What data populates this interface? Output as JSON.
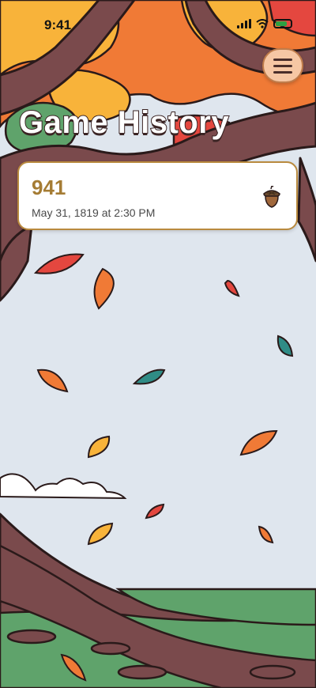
{
  "status_bar": {
    "time": "9:41"
  },
  "header": {
    "title": "Game History"
  },
  "menu": {
    "icon": "hamburger-menu-icon"
  },
  "history": [
    {
      "score": "941",
      "date": "May 31, 1819 at 2:30 PM",
      "icon": "acorn-icon"
    }
  ],
  "colors": {
    "sky": "#dfe6ee",
    "trunk": "#7a4a4c",
    "outline": "#2a1a1a",
    "leaf_orange": "#f07a36",
    "leaf_yellow": "#f8b33a",
    "leaf_red": "#e4473f",
    "leaf_teal": "#2f8c86",
    "grass": "#5fa36b",
    "card_border": "#b98a3e",
    "score_gold": "#a57c34"
  }
}
